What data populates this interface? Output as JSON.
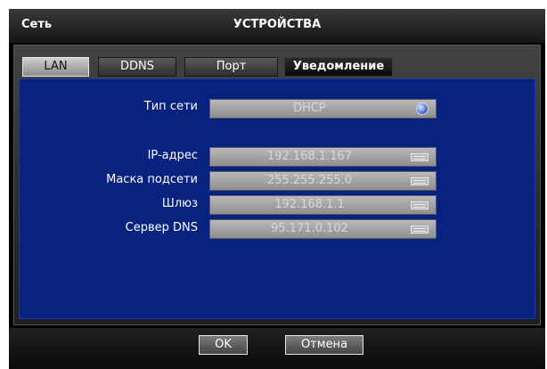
{
  "window": {
    "section_title": "Сеть",
    "title": "УСТРОЙСТВА"
  },
  "tabs": [
    {
      "label": "LAN",
      "state": "active"
    },
    {
      "label": "DDNS",
      "state": "inactive"
    },
    {
      "label": "Порт",
      "state": "inactive"
    },
    {
      "label": "Уведомление",
      "state": "dark"
    }
  ],
  "form": {
    "network_type": {
      "label": "Тип сети",
      "value": "DHCP",
      "icon": "globe-icon"
    },
    "ip": {
      "label": "IP-адрес",
      "value": "192.168.1.167",
      "icon": "keyboard-icon"
    },
    "mask": {
      "label": "Маска подсети",
      "value": "255.255.255.0",
      "icon": "keyboard-icon"
    },
    "gateway": {
      "label": "Шлюз",
      "value": "192.168.1.1",
      "icon": "keyboard-icon"
    },
    "dns": {
      "label": "Сервер DNS",
      "value": "95.171.0.102",
      "icon": "keyboard-icon"
    }
  },
  "buttons": {
    "ok": "OK",
    "cancel": "Отмена"
  },
  "colors": {
    "content_bg": "#08227f",
    "field_bg": "#a3a3a3",
    "text": "#ffffff"
  }
}
